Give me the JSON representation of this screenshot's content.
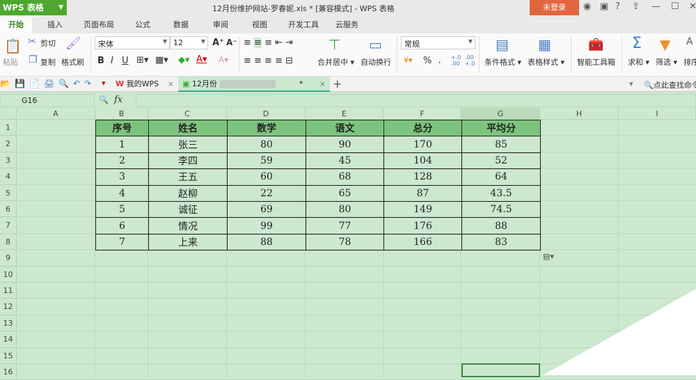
{
  "app": {
    "name": "WPS 表格",
    "window_title": "12月份维护网站-罗春妮.xls * [兼容模式] - WPS 表格",
    "login": "未登录"
  },
  "menu": [
    "开始",
    "插入",
    "页面布局",
    "公式",
    "数据",
    "审阅",
    "视图",
    "开发工具",
    "云服务"
  ],
  "ribbon": {
    "paste": "粘贴",
    "cut": "剪切",
    "copy": "复制",
    "format_painter": "格式刷",
    "font": "宋体",
    "size": "12",
    "bold": "B",
    "italic": "I",
    "underline": "U",
    "merge": "合并居中",
    "wrap": "自动换行",
    "number_format": "常规",
    "percent": "%",
    "cond_format": "条件格式",
    "table_style": "表格样式",
    "toolbox": "智能工具箱",
    "sum": "求和",
    "filter": "筛选",
    "sort": "排序"
  },
  "doc_tabs": {
    "home": "我的WPS",
    "file": "12月份",
    "modified": "*",
    "search": "点此查找命令"
  },
  "formula": {
    "cell": "G16",
    "fx": "fx"
  },
  "columns": [
    "A",
    "B",
    "C",
    "D",
    "E",
    "F",
    "G",
    "H",
    "I"
  ],
  "rows": [
    "1",
    "2",
    "3",
    "4",
    "5",
    "6",
    "7",
    "8",
    "9",
    "10",
    "11",
    "12",
    "13",
    "14",
    "15",
    "16"
  ],
  "table": {
    "headers": [
      "序号",
      "姓名",
      "数学",
      "语文",
      "总分",
      "平均分"
    ],
    "rows": [
      [
        "1",
        "张三",
        "80",
        "90",
        "170",
        "85"
      ],
      [
        "2",
        "李四",
        "59",
        "45",
        "104",
        "52"
      ],
      [
        "3",
        "王五",
        "60",
        "68",
        "128",
        "64"
      ],
      [
        "4",
        "赵柳",
        "22",
        "65",
        "87",
        "43.5"
      ],
      [
        "5",
        "诚征",
        "69",
        "80",
        "149",
        "74.5"
      ],
      [
        "6",
        "情况",
        "99",
        "77",
        "176",
        "88"
      ],
      [
        "7",
        "上来",
        "88",
        "78",
        "166",
        "83"
      ]
    ]
  }
}
